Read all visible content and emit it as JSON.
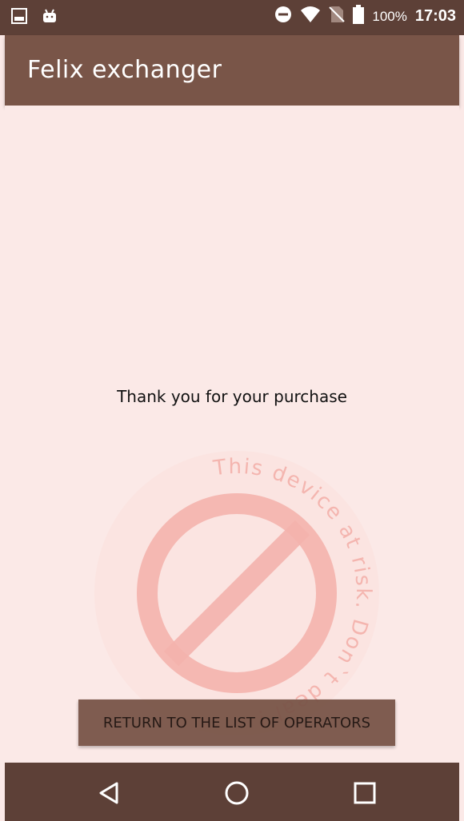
{
  "status_bar": {
    "icons": [
      "image-icon",
      "android-icon",
      "do-not-disturb-icon",
      "wifi-icon",
      "no-sim-icon",
      "battery-icon"
    ],
    "battery": "100%",
    "time": "17:03"
  },
  "app_bar": {
    "title": "Felix exchanger"
  },
  "main": {
    "message": "Thank you for your purchase",
    "watermark_text": "This device at risk. Don`t deal !",
    "return_button_label": "RETURN TO THE LIST OF OPERATORS"
  },
  "nav_bar": {
    "buttons": [
      "back-icon",
      "home-icon",
      "recents-icon"
    ]
  },
  "colors": {
    "primary": "#795548",
    "primary_dark": "#5d4037",
    "background": "#fbe9e7",
    "watermark": "#f1a7a1"
  }
}
